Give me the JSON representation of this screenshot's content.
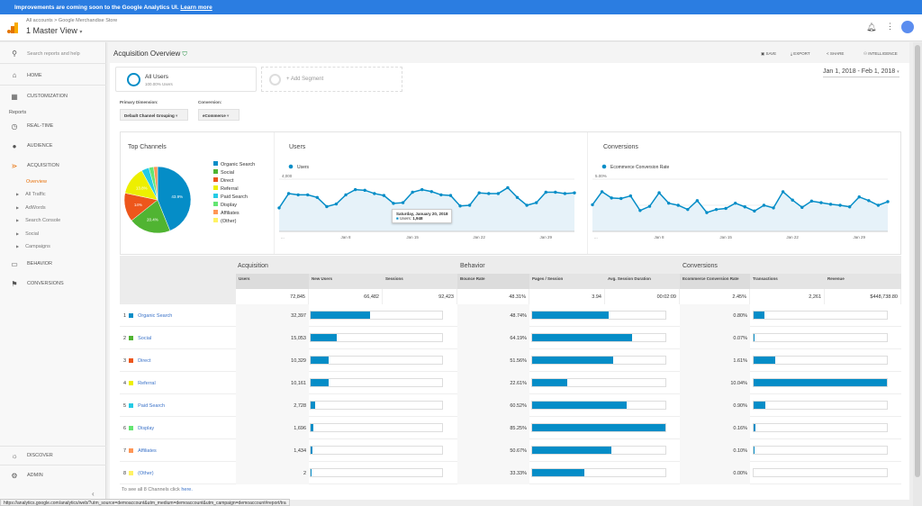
{
  "banner": {
    "text": "Improvements are coming soon to the Google Analytics UI.",
    "link": "Learn more"
  },
  "header": {
    "breadcrumb": "All accounts > Google Merchandise Store",
    "view": "1 Master View"
  },
  "sidebar": {
    "search_placeholder": "Search reports and help",
    "home": "HOME",
    "customization": "CUSTOMIZATION",
    "reports_label": "Reports",
    "items": [
      {
        "label": "REAL-TIME",
        "icon": "clock-icon"
      },
      {
        "label": "AUDIENCE",
        "icon": "person-icon"
      },
      {
        "label": "ACQUISITION",
        "icon": "acquisition-icon"
      }
    ],
    "acq_overview": "Overview",
    "acq_sub": [
      "All Traffic",
      "AdWords",
      "Search Console",
      "Social",
      "Campaigns"
    ],
    "behavior": "BEHAVIOR",
    "conversions": "CONVERSIONS",
    "discover": "DISCOVER",
    "admin": "ADMIN"
  },
  "page": {
    "title": "Acquisition Overview",
    "actions": {
      "save": "SAVE",
      "export": "EXPORT",
      "share": "SHARE",
      "intelligence": "INTELLIGENCE"
    },
    "date_range": "Jan 1, 2018 - Feb 1, 2018",
    "segment": {
      "name": "All Users",
      "sub": "100.00% Users",
      "add": "+ Add Segment"
    },
    "primary_dimension_label": "Primary Dimension:",
    "primary_dimension": "Default Channel Grouping",
    "conversion_label": "Conversion:",
    "conversion": "eCommerce"
  },
  "chart_data": [
    {
      "type": "pie",
      "title": "Top Channels",
      "categories": [
        "Organic Search",
        "Social",
        "Direct",
        "Referral",
        "Paid Search",
        "Display",
        "Affiliates",
        "(Other)"
      ],
      "values": [
        43.9,
        20.4,
        14,
        13.8,
        3.7,
        2.3,
        1.9,
        0.0
      ],
      "labels": [
        "43.9%",
        "20.4%",
        "14%",
        "13.8%",
        "",
        "",
        "",
        ""
      ],
      "colors": [
        "#058dc7",
        "#50b432",
        "#ed561b",
        "#edef00",
        "#24cbe5",
        "#64e572",
        "#ff9655",
        "#fff263"
      ],
      "legend": "right"
    },
    {
      "type": "area",
      "title": "Users",
      "series": [
        {
          "name": "Users",
          "values": [
            1800,
            2900,
            2800,
            2800,
            2600,
            1900,
            2100,
            2800,
            3200,
            3150,
            2900,
            2750,
            2150,
            2200,
            3000,
            3200,
            3050,
            2800,
            2750,
            1948,
            2000,
            2950,
            2900,
            2900,
            3350,
            2600,
            2000,
            2200,
            3000,
            3000,
            2900,
            2950
          ]
        }
      ],
      "ylim": [
        0,
        4000
      ],
      "yticks": [
        "4,000",
        "2,000"
      ],
      "xticks": [
        "...",
        "Jan 8",
        "Jan 15",
        "Jan 22",
        "Jan 29"
      ],
      "tooltip": {
        "title": "Saturday, January 20, 2018",
        "label": "Users:",
        "value": "1,948"
      }
    },
    {
      "type": "area",
      "title": "Conversions",
      "series": [
        {
          "name": "Ecommerce Conversion Rate",
          "values": [
            2.55,
            3.8,
            3.2,
            3.15,
            3.4,
            2.0,
            2.4,
            3.7,
            2.7,
            2.5,
            2.1,
            2.95,
            1.8,
            2.1,
            2.2,
            2.7,
            2.35,
            1.95,
            2.5,
            2.25,
            3.8,
            3.0,
            2.3,
            2.9,
            2.75,
            2.6,
            2.5,
            2.35,
            3.3,
            2.95,
            2.5,
            2.85
          ]
        }
      ],
      "ylim": [
        0,
        5
      ],
      "yticks": [
        "5.00%",
        "2.50%"
      ],
      "xticks": [
        "...",
        "Jan 8",
        "Jan 15",
        "Jan 22",
        "Jan 29"
      ]
    }
  ],
  "table": {
    "groups": [
      "Acquisition",
      "Behavior",
      "Conversions"
    ],
    "columns": [
      "Users",
      "New Users",
      "Sessions",
      "Bounce Rate",
      "Pages / Session",
      "Avg. Session Duration",
      "Ecommerce Conversion Rate",
      "Transactions",
      "Revenue"
    ],
    "totals": [
      "72,845",
      "66,482",
      "92,423",
      "48.31%",
      "3.94",
      "00:02:09",
      "2.45%",
      "2,261",
      "$448,738.80"
    ],
    "rows": [
      {
        "n": "1",
        "name": "Organic Search",
        "color": "#058dc7",
        "users": "32,397",
        "new_users_share": 0.45,
        "bounce": "48.74%",
        "bounce_v": 48.74,
        "conv": "0.80%",
        "conv_v": 0.8
      },
      {
        "n": "2",
        "name": "Social",
        "color": "#50b432",
        "users": "15,053",
        "new_users_share": 0.2,
        "bounce": "64.19%",
        "bounce_v": 64.19,
        "conv": "0.07%",
        "conv_v": 0.07
      },
      {
        "n": "3",
        "name": "Direct",
        "color": "#ed561b",
        "users": "10,329",
        "new_users_share": 0.14,
        "bounce": "51.56%",
        "bounce_v": 51.56,
        "conv": "1.61%",
        "conv_v": 1.61
      },
      {
        "n": "4",
        "name": "Referral",
        "color": "#edef00",
        "users": "10,161",
        "new_users_share": 0.135,
        "bounce": "22.61%",
        "bounce_v": 22.61,
        "conv": "10.04%",
        "conv_v": 10.04
      },
      {
        "n": "5",
        "name": "Paid Search",
        "color": "#24cbe5",
        "users": "2,728",
        "new_users_share": 0.035,
        "bounce": "60.52%",
        "bounce_v": 60.52,
        "conv": "0.90%",
        "conv_v": 0.9
      },
      {
        "n": "6",
        "name": "Display",
        "color": "#64e572",
        "users": "1,696",
        "new_users_share": 0.02,
        "bounce": "85.25%",
        "bounce_v": 85.25,
        "conv": "0.16%",
        "conv_v": 0.16
      },
      {
        "n": "7",
        "name": "Affiliates",
        "color": "#ff9655",
        "users": "1,434",
        "new_users_share": 0.015,
        "bounce": "50.67%",
        "bounce_v": 50.67,
        "conv": "0.10%",
        "conv_v": 0.1
      },
      {
        "n": "8",
        "name": "(Other)",
        "color": "#fff263",
        "users": "2",
        "new_users_share": 0.002,
        "bounce": "33.33%",
        "bounce_v": 33.33,
        "conv": "0.00%",
        "conv_v": 0.0
      }
    ],
    "footer": "To see all 8 Channels click",
    "footer_link": "here."
  },
  "status_url": "https://analytics.google.com/analytics/web/?utm_source=demoaccount&utm_medium=demoaccount&utm_campaign=demoaccount#report/tra"
}
